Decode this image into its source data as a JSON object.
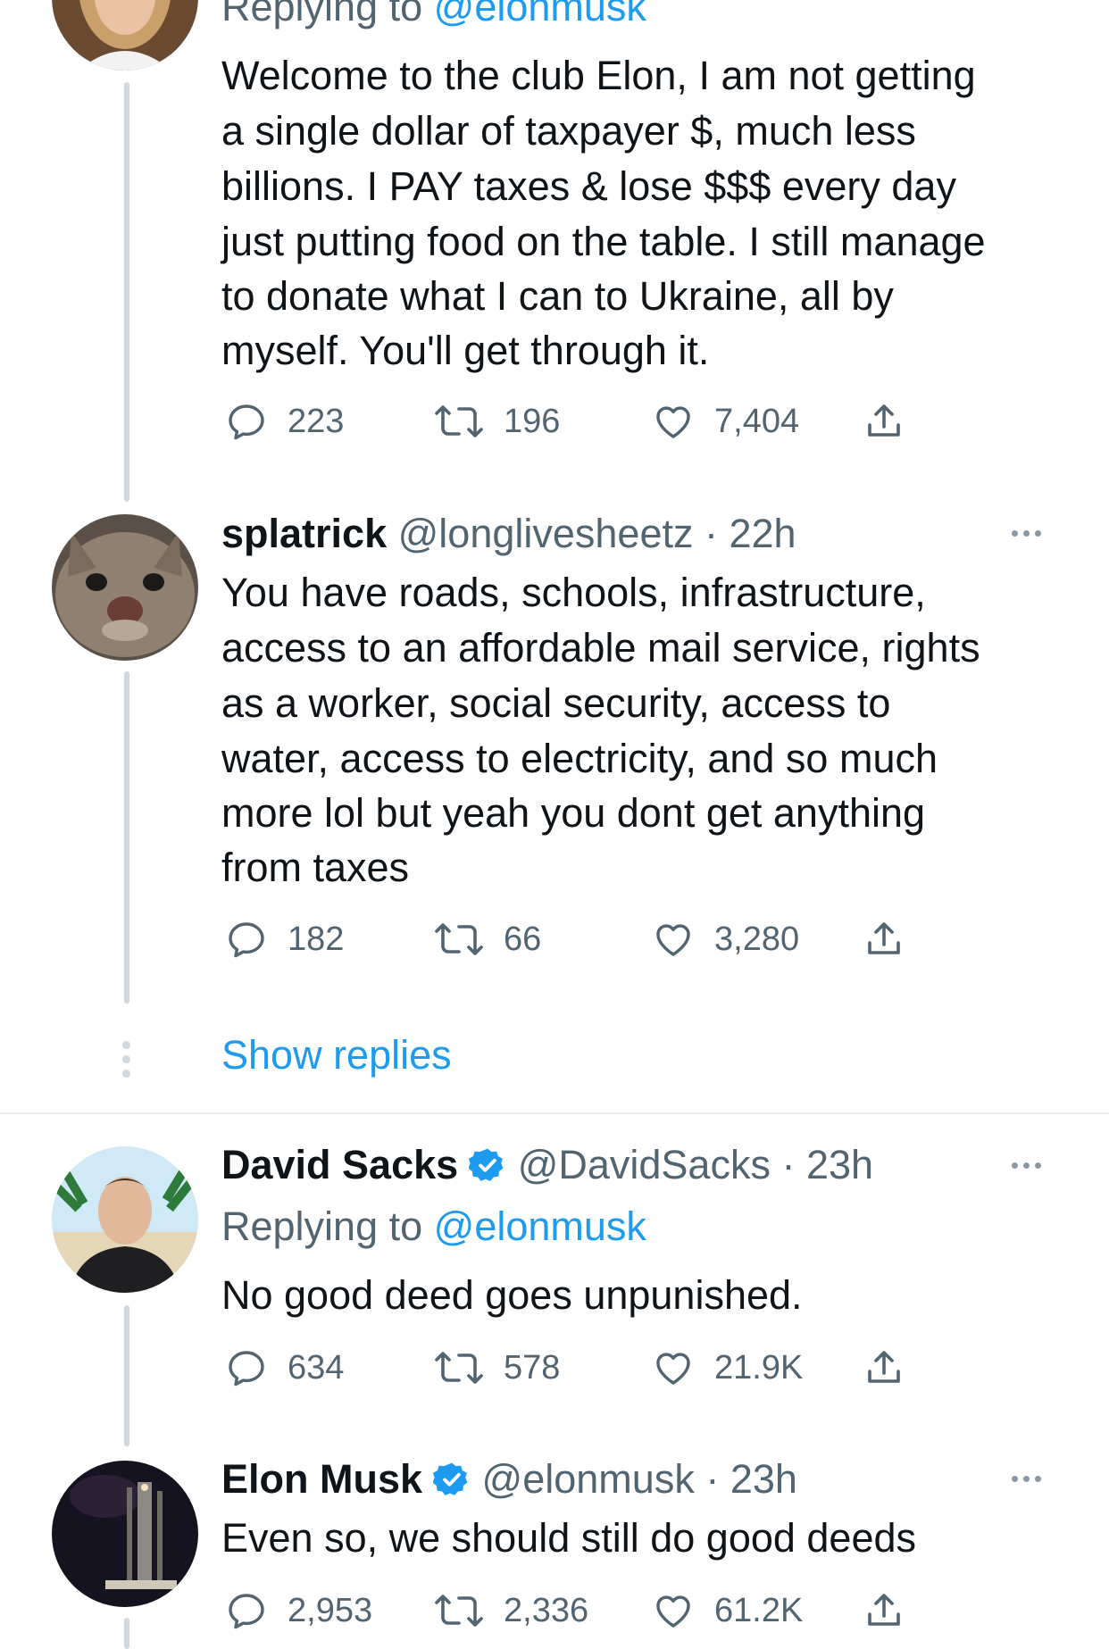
{
  "tweets": [
    {
      "replying_prefix": "Replying to ",
      "replying_handle": "@elonmusk",
      "lines": [
        "Welcome to the club Elon, I am not getting",
        "a single dollar of taxpayer $, much less",
        "billions. I PAY taxes & lose $$$ every day",
        "just putting food on the table. I still manage",
        "to donate what I can to Ukraine, all by",
        "myself. You'll get through it."
      ],
      "replies": "223",
      "retweets": "196",
      "likes": "7,404"
    },
    {
      "name": "splatrick",
      "handle": "@longlivesheetz",
      "time": "22h",
      "lines": [
        "You have roads, schools, infrastructure,",
        "access to an affordable mail service, rights",
        "as a worker, social security, access to",
        "water, access to electricity, and so much",
        "more lol but yeah you dont get anything",
        "from taxes"
      ],
      "replies": "182",
      "retweets": "66",
      "likes": "3,280"
    },
    {
      "name": "David Sacks",
      "handle": "@DavidSacks",
      "time": "23h",
      "replying_prefix": "Replying to ",
      "replying_handle": "@elonmusk",
      "lines": [
        "No good deed goes unpunished."
      ],
      "replies": "634",
      "retweets": "578",
      "likes": "21.9K"
    },
    {
      "name": "Elon Musk",
      "handle": "@elonmusk",
      "time": "23h",
      "lines": [
        "Even so, we should still do good deeds"
      ],
      "replies": "2,953",
      "retweets": "2,336",
      "likes": "61.2K"
    }
  ],
  "show_replies": "Show replies",
  "separator": "·",
  "colors": {
    "accent": "#1d9bf0",
    "muted": "#536471",
    "thread": "#cfd9de"
  }
}
